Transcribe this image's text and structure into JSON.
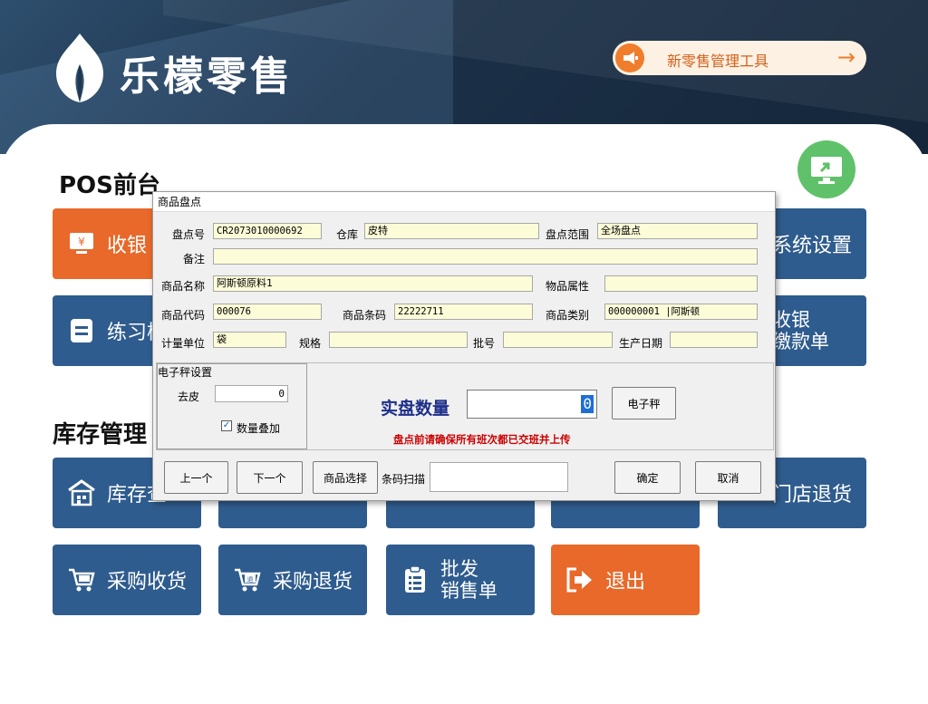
{
  "brand": {
    "name": "乐檬零售"
  },
  "promo": {
    "label": "新零售管理工具",
    "arrow": "→"
  },
  "sections": {
    "pos": "POS前台",
    "inventory": "库存管理"
  },
  "tiles": {
    "cashier": "收银",
    "practice": "练习模",
    "settings": "系统设置",
    "payment_line1": "收银",
    "payment_line2": "缴款单",
    "stock_query": "库存查",
    "store_return": "门店退货",
    "purchase_receive": "采购收货",
    "purchase_return": "采购退货",
    "wholesale_line1": "批发",
    "wholesale_line2": "销售单",
    "exit": "退出"
  },
  "dialog": {
    "title": "商品盘点",
    "labels": {
      "count_no": "盘点号",
      "warehouse": "仓库",
      "count_scope": "盘点范围",
      "remark": "备注",
      "product_name": "商品名称",
      "attribute": "物品属性",
      "product_code": "商品代码",
      "barcode": "商品条码",
      "category": "商品类别",
      "unit": "计量单位",
      "spec": "规格",
      "batch": "批号",
      "mfg_date": "生产日期",
      "scale_settings": "电子秤设置",
      "tare": "去皮",
      "qty_add": "数量叠加",
      "actual_qty": "实盘数量",
      "scan": "条码扫描"
    },
    "values": {
      "count_no": "CR2073010000692",
      "warehouse": "皮特",
      "count_scope": "全场盘点",
      "remark": "",
      "product_name": "阿斯顿原料1",
      "attribute": "",
      "product_code": "000076",
      "barcode": "22222711",
      "category": "000000001 |阿斯顿",
      "unit": "袋",
      "spec": "",
      "batch": "",
      "mfg_date": "",
      "tare": "0",
      "actual_qty": "0",
      "scan": ""
    },
    "warning": "盘点前请确保所有班次都已交班并上传",
    "buttons": {
      "scale": "电子秤",
      "prev": "上一个",
      "next": "下一个",
      "select": "商品选择",
      "ok": "确定",
      "cancel": "取消"
    }
  },
  "colors": {
    "tile_blue": "#2f5c8e",
    "tile_orange": "#e8692a",
    "field_yellow": "#fdfcd8",
    "warning_red": "#cc0000",
    "qty_label": "#1e2f8a"
  }
}
